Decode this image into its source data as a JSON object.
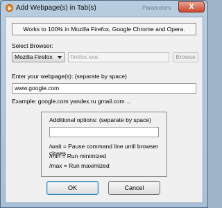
{
  "window": {
    "title": "Add Webpage(s) in Tab(s)",
    "background_title": "Parameters",
    "close_label": "X"
  },
  "info": "Works to 100% in Mozilla Firefox, Google Chrome and Opera.",
  "browser": {
    "label": "Select Browser:",
    "selected": "Mozilla Firefox",
    "path_value": "firefox.exe",
    "browse_label": "Browse"
  },
  "webpages": {
    "label": "Enter your webpage(s): (separate by space)",
    "value": "www.google.com",
    "example": "Example: google.com yandex.ru gmail.com ..."
  },
  "options": {
    "label": "Additional options: (separate by space)",
    "value": "",
    "items": [
      "/wait = Pause command line until browser closes",
      "/min = Run minimized",
      "/max = Run maximized"
    ]
  },
  "buttons": {
    "ok": "OK",
    "cancel": "Cancel"
  },
  "colors": {
    "titlebar": "#b4c9de",
    "close": "#c8482e",
    "app_icon": "#f58220"
  }
}
